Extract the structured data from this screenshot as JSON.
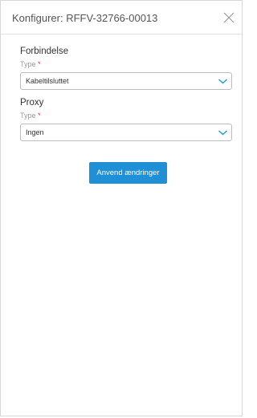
{
  "header": {
    "title": "Konfigurer: RFFV-32766-00013"
  },
  "connection": {
    "section_title": "Forbindelse",
    "type_label": "Type",
    "required_marker": "*",
    "selected": "Kabeltilsluttet"
  },
  "proxy": {
    "section_title": "Proxy",
    "type_label": "Type",
    "required_marker": "*",
    "selected": "Ingen"
  },
  "actions": {
    "apply_label": "Anvend ændringer"
  },
  "colors": {
    "accent": "#1f8fd6",
    "chevron": "#1f9fd8",
    "required": "#e0393e"
  },
  "icons": {
    "close": "close-icon",
    "dropdown": "chevron-down-icon"
  }
}
